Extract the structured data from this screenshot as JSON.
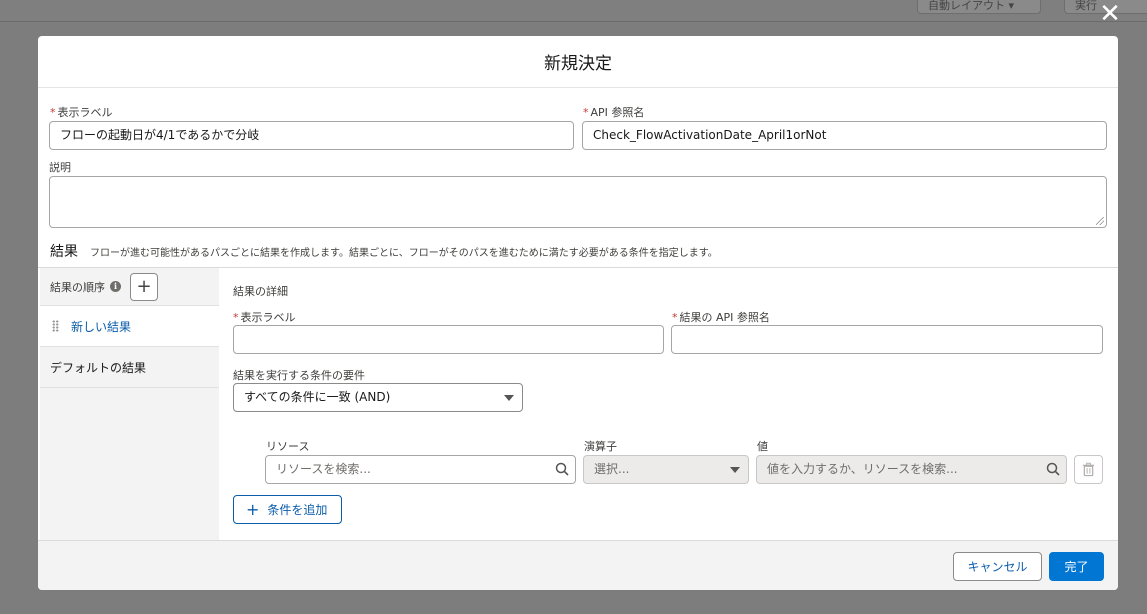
{
  "background": {
    "button_1": "自動レイアウト ▾",
    "button_2": "実行"
  },
  "modal": {
    "title": "新規決定",
    "close_icon": "close-icon",
    "display_label": {
      "label": "表示ラベル",
      "value": "フローの起動日が4/1であるかで分岐"
    },
    "api_name": {
      "label": "API 参照名",
      "value": "Check_FlowActivationDate_April1orNot"
    },
    "description": {
      "label": "説明",
      "value": ""
    }
  },
  "results": {
    "title": "結果",
    "description": "フローが進む可能性があるパスごとに結果を作成します。結果ごとに、フローがそのパスを進むために満たす必要がある条件を指定します。",
    "order_label": "結果の順序",
    "info_icon": "info-icon",
    "outcomes": [
      {
        "label": "新しい結果",
        "active": true
      },
      {
        "label": "デフォルトの結果",
        "active": false
      }
    ]
  },
  "details": {
    "heading": "結果の詳細",
    "display_label": {
      "label": "表示ラベル",
      "value": ""
    },
    "api_name": {
      "label": "結果の API 参照名",
      "value": ""
    },
    "requirement": {
      "label": "結果を実行する条件の要件",
      "selected": "すべての条件に一致 (AND)"
    },
    "condition": {
      "resource": {
        "label": "リソース",
        "placeholder": "リソースを検索..."
      },
      "operator": {
        "label": "演算子",
        "placeholder": "選択..."
      },
      "value": {
        "label": "値",
        "placeholder": "値を入力するか、リソースを検索..."
      }
    },
    "add_condition_label": "条件を追加"
  },
  "footer": {
    "cancel_label": "キャンセル",
    "done_label": "完了"
  },
  "colors": {
    "accent": "#0176d3",
    "link": "#0b5cab",
    "required": "#c23934"
  }
}
